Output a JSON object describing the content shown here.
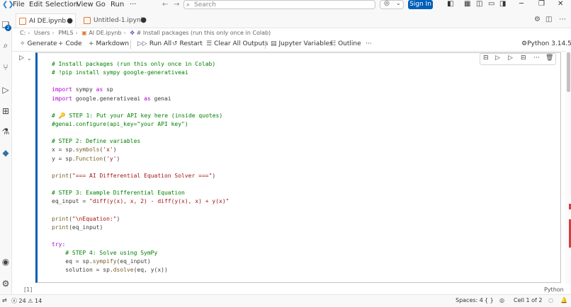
{
  "menu": [
    "File",
    "Edit",
    "Selection",
    "View",
    "Go",
    "Run",
    "···"
  ],
  "search": {
    "placeholder": "Search"
  },
  "account": {
    "sign_in_label": "Sign In"
  },
  "tabs": [
    {
      "label": "AI DE.ipynb",
      "active": true,
      "dirty": true
    },
    {
      "label": "Untitled-1.ipynb",
      "active": false,
      "dirty": true
    }
  ],
  "breadcrumb": [
    "C:",
    "Users",
    "PMLS",
    "AI DE.ipynb",
    "# Install packages (run this only once in Colab)"
  ],
  "notebook_toolbar": {
    "generate": "Generate",
    "code": "Code",
    "markdown": "Markdown",
    "run_all": "Run All",
    "restart": "Restart",
    "clear_outputs": "Clear All Outputs",
    "variables": "Jupyter Variables",
    "outline": "Outline",
    "more": "···",
    "kernel": "Python 3.14.5"
  },
  "activity_badge": "2",
  "cell": {
    "execution_count": "[1]",
    "language": "Python",
    "code_lines": [
      "# Install packages (run this only once in Colab)",
      "# !pip install sympy google-generativeai",
      "",
      "import sympy as sp",
      "import google.generativeai as genai",
      "",
      "# 🔑 STEP 1: Put your API key here (inside quotes)",
      "#genai.configure(api_key=\"your API key\")",
      "",
      "# STEP 2: Define variables",
      "x = sp.symbols('x')",
      "y = sp.Function('y')",
      "",
      "print(\"=== AI Differential Equation Solver ===\")",
      "",
      "# STEP 3: Example Differential Equation",
      "eq_input = \"diff(y(x), x, 2) - diff(y(x), x) + y(x)\"",
      "",
      "print(\"\\nEquation:\")",
      "print(eq_input)",
      "",
      "try:",
      "    # STEP 4: Solve using SymPy",
      "    eq = sp.sympify(eq_input)",
      "    solution = sp.dsolve(eq, y(x))",
      ""
    ]
  },
  "status_bar": {
    "errors": "24",
    "warnings": "14",
    "spaces": "Spaces: 4",
    "braces": "{ }",
    "cell_pos": "Cell 1 of 2"
  },
  "colors": {
    "accent": "#005fb8",
    "comment": "#008000",
    "keyword": "#af00db",
    "string": "#a31515"
  }
}
